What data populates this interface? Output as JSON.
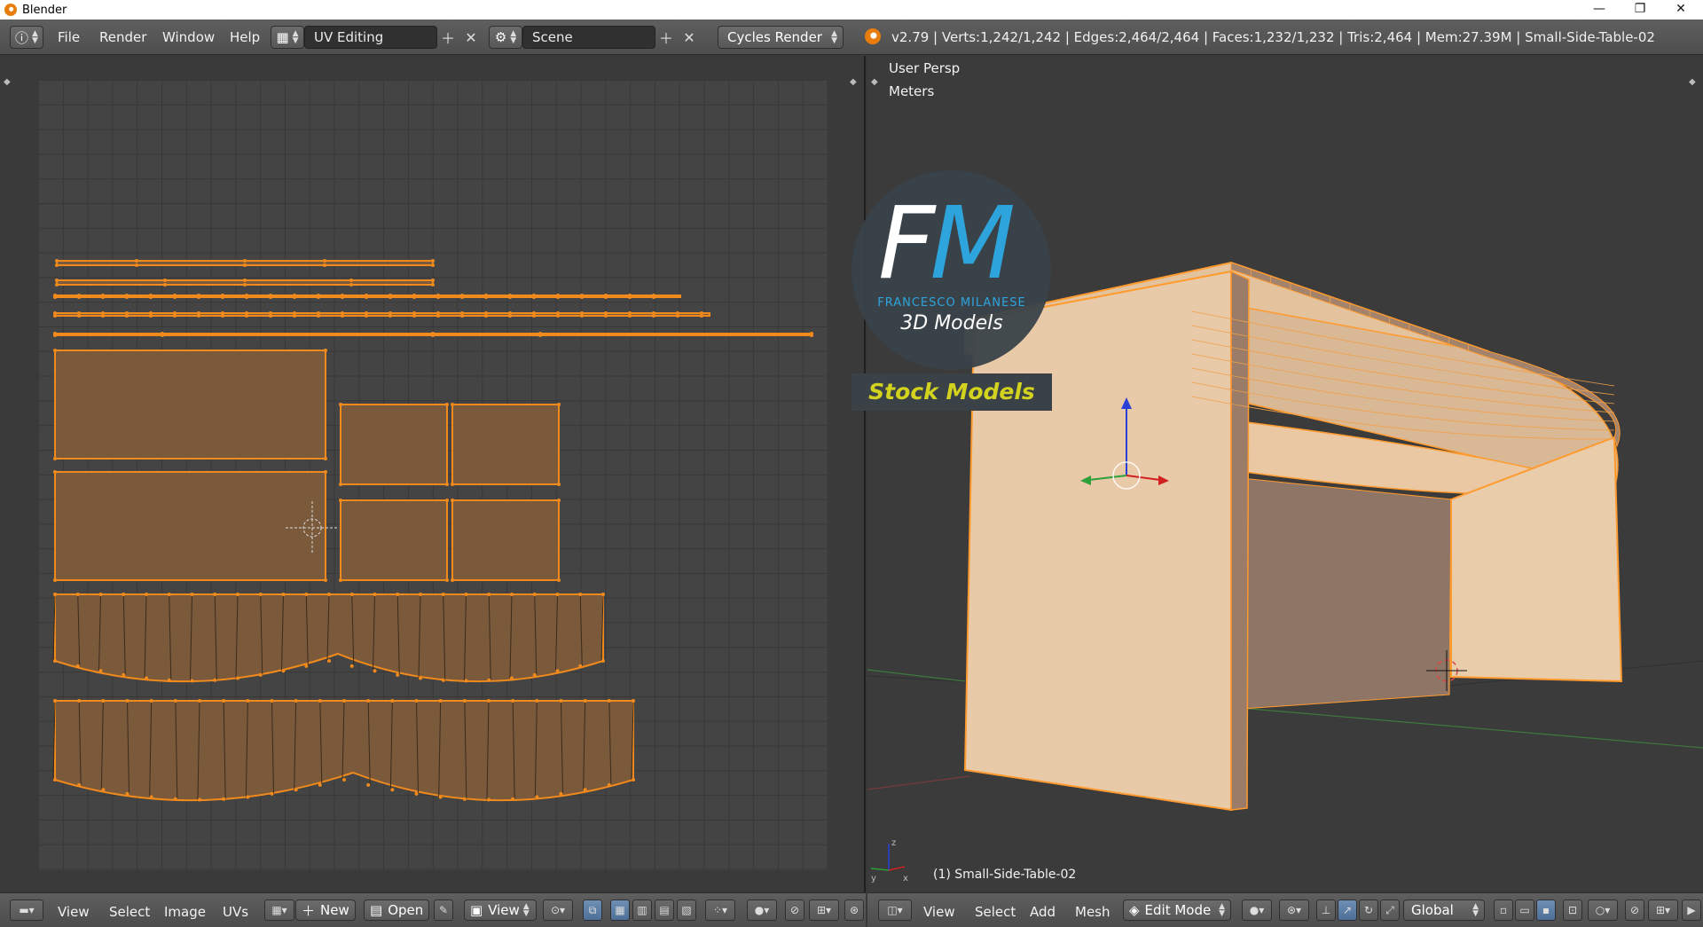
{
  "window": {
    "title": "Blender",
    "minimize": "—",
    "restore": "❐",
    "close": "✕"
  },
  "info_header": {
    "menus": [
      "File",
      "Render",
      "Window",
      "Help"
    ],
    "screen_layout": "UV Editing",
    "scene": "Scene",
    "render_engine": "Cycles Render",
    "stats": "v2.79 | Verts:1,242/1,242 | Edges:2,464/2,464 | Faces:1,232/1,232 | Tris:2,464 | Mem:27.39M | Small-Side-Table-02"
  },
  "viewport": {
    "view_name": "User Persp",
    "units": "Meters",
    "object_label": "(1) Small-Side-Table-02"
  },
  "watermark": {
    "letter_f": "F",
    "letter_m": "M",
    "name": "FRANCESCO MILANESE",
    "subtitle": "3D Models",
    "banner": "Stock Models"
  },
  "uv_footer": {
    "menus": [
      "View",
      "Select",
      "Image",
      "UVs"
    ],
    "new_label": "New",
    "open_label": "Open",
    "view_label": "View"
  },
  "viewport_footer": {
    "menus": [
      "View",
      "Select",
      "Add",
      "Mesh"
    ],
    "mode": "Edit Mode",
    "orientation": "Global"
  },
  "colors": {
    "uv_face_fill": "#7b5a3c",
    "uv_edge": "#f08a1c",
    "mesh_face": "#e8c9a6",
    "accent_blue": "#2ea4dc",
    "banner_text": "#d2d21f"
  }
}
